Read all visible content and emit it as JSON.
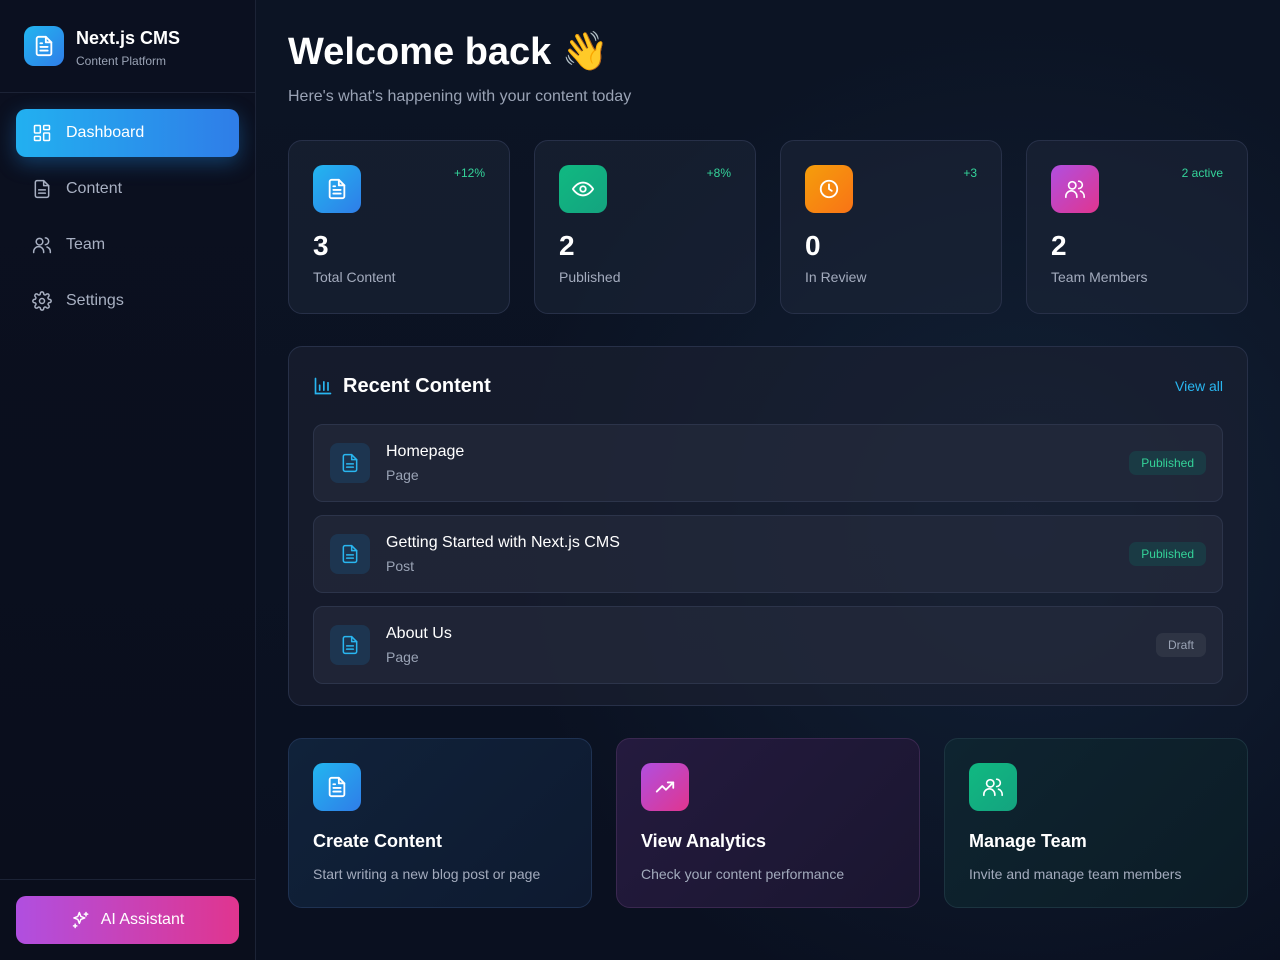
{
  "brand": {
    "title": "Next.js CMS",
    "subtitle": "Content Platform",
    "logo_icon": "document-icon"
  },
  "sidebar": {
    "items": [
      {
        "label": "Dashboard",
        "icon": "dashboard-icon",
        "active": true
      },
      {
        "label": "Content",
        "icon": "document-icon",
        "active": false
      },
      {
        "label": "Team",
        "icon": "users-icon",
        "active": false
      },
      {
        "label": "Settings",
        "icon": "gear-icon",
        "active": false
      }
    ],
    "ai_button": {
      "label": "AI Assistant",
      "icon": "sparkles-icon"
    }
  },
  "header": {
    "title": "Welcome back 👋",
    "subtitle": "Here's what's happening with your content today"
  },
  "stats": [
    {
      "value": "3",
      "label": "Total Content",
      "delta": "+12%",
      "icon": "document-icon",
      "color": "#22b6f0"
    },
    {
      "value": "2",
      "label": "Published",
      "delta": "+8%",
      "icon": "eye-icon",
      "color": "#10b981"
    },
    {
      "value": "0",
      "label": "In Review",
      "delta": "+3",
      "icon": "clock-icon",
      "color": "#f59e0b"
    },
    {
      "value": "2",
      "label": "Team Members",
      "delta": "2 active",
      "icon": "users-icon",
      "color": "#c04ad8"
    }
  ],
  "recent": {
    "title": "Recent Content",
    "view_all": "View all",
    "items": [
      {
        "title": "Homepage",
        "type": "Page",
        "status": "Published"
      },
      {
        "title": "Getting Started with Next.js CMS",
        "type": "Post",
        "status": "Published"
      },
      {
        "title": "About Us",
        "type": "Page",
        "status": "Draft"
      }
    ]
  },
  "quick_actions": [
    {
      "title": "Create Content",
      "desc": "Start writing a new blog post or page",
      "icon": "document-icon"
    },
    {
      "title": "View Analytics",
      "desc": "Check your content performance",
      "icon": "trending-up-icon"
    },
    {
      "title": "Manage Team",
      "desc": "Invite and manage team members",
      "icon": "users-icon"
    }
  ],
  "colors": {
    "accent": "#2f9bee",
    "success": "#34d399",
    "background": "#0a0f1e"
  }
}
